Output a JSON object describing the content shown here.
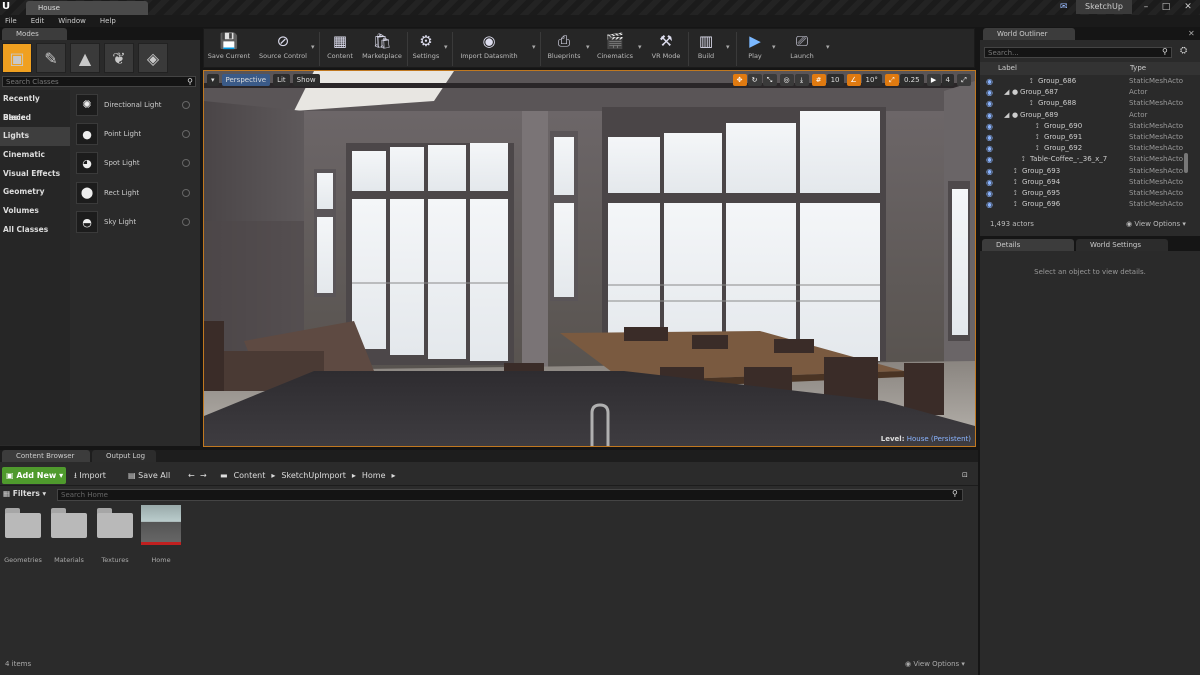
{
  "titlebar": {
    "logo": "U",
    "doc_tab": "House",
    "brand": "SketchUp"
  },
  "menu": [
    "File",
    "Edit",
    "Window",
    "Help"
  ],
  "modes": {
    "tab": "Modes",
    "search_placeholder": "Search Classes",
    "categories": [
      "Recently Placed",
      "Basic",
      "Lights",
      "Cinematic",
      "Visual Effects",
      "Geometry",
      "Volumes",
      "All Classes"
    ],
    "selected_category": "Lights",
    "assets": [
      {
        "label": "Directional Light",
        "icon": "sun-icon"
      },
      {
        "label": "Point Light",
        "icon": "bulb-icon"
      },
      {
        "label": "Spot Light",
        "icon": "spotlight-icon"
      },
      {
        "label": "Rect Light",
        "icon": "sphere-icon"
      },
      {
        "label": "Sky Light",
        "icon": "dome-icon"
      }
    ]
  },
  "toolbar": {
    "buttons": [
      "Save Current",
      "Source Control",
      "Content",
      "Marketplace",
      "Settings",
      "Import Datasmith",
      "Blueprints",
      "Cinematics",
      "VR Mode",
      "Build",
      "Play",
      "Launch"
    ]
  },
  "viewport": {
    "perspective": "Perspective",
    "lit": "Lit",
    "show": "Show",
    "grid_snap": "10",
    "rot_snap": "10°",
    "scale_snap": "0.25",
    "cam_speed": "4",
    "level_label": "Level:",
    "level_name": "House (Persistent)"
  },
  "content_browser": {
    "tab": "Content Browser",
    "output_tab": "Output Log",
    "add_new": "Add New",
    "import": "Import",
    "save_all": "Save All",
    "breadcrumb": [
      "Content",
      "SketchUpImport",
      "Home"
    ],
    "filters": "Filters",
    "search_placeholder": "Search Home",
    "items": [
      "Geometries",
      "Materials",
      "Textures",
      "Home"
    ],
    "count": "4 items",
    "view_options": "View Options"
  },
  "world_outliner": {
    "tab": "World Outliner",
    "search_placeholder": "Search...",
    "col_label": "Label",
    "col_type": "Type",
    "rows": [
      {
        "label": "Group_686",
        "type": "StaticMeshActo"
      },
      {
        "label": "Group_687",
        "type": "Actor"
      },
      {
        "label": "Group_688",
        "type": "StaticMeshActo"
      },
      {
        "label": "Group_689",
        "type": "Actor"
      },
      {
        "label": "Group_690",
        "type": "StaticMeshActo"
      },
      {
        "label": "Group_691",
        "type": "StaticMeshActo"
      },
      {
        "label": "Group_692",
        "type": "StaticMeshActo"
      },
      {
        "label": "Table-Coffee_-_36_x_7",
        "type": "StaticMeshActo"
      },
      {
        "label": "Group_693",
        "type": "StaticMeshActo"
      },
      {
        "label": "Group_694",
        "type": "StaticMeshActo"
      },
      {
        "label": "Group_695",
        "type": "StaticMeshActo"
      },
      {
        "label": "Group_696",
        "type": "StaticMeshActo"
      }
    ],
    "count": "1,493 actors",
    "view_options": "View Options"
  },
  "details": {
    "tab": "Details",
    "world_settings_tab": "World Settings",
    "hint": "Select an object to view details."
  }
}
